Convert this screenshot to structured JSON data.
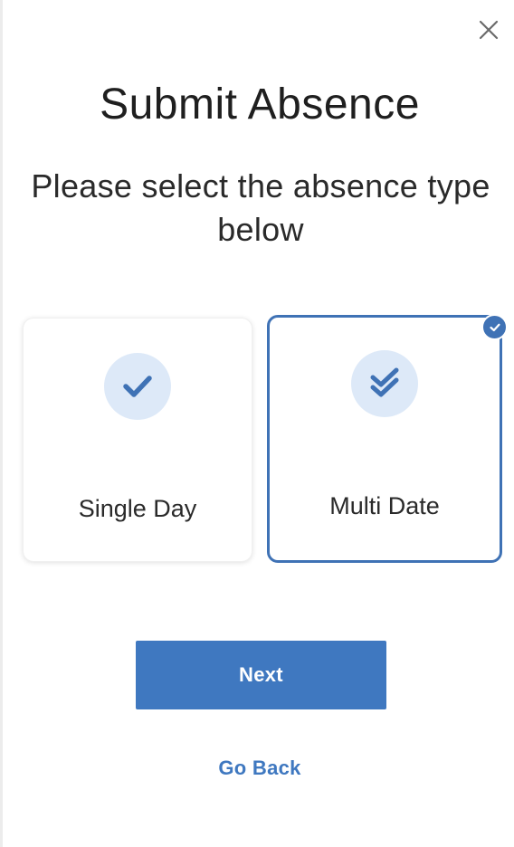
{
  "dialog": {
    "title": "Submit Absence",
    "subtitle": "Please select the absence type below",
    "close_icon": "close-icon"
  },
  "options": [
    {
      "label": "Single Day",
      "icon": "check-icon",
      "selected": false
    },
    {
      "label": "Multi Date",
      "icon": "double-check-icon",
      "selected": true
    }
  ],
  "actions": {
    "next_label": "Next",
    "back_label": "Go Back"
  },
  "colors": {
    "accent": "#3f78c0",
    "icon_bg": "#dde9f8",
    "selected_border": "#3f72b5"
  }
}
